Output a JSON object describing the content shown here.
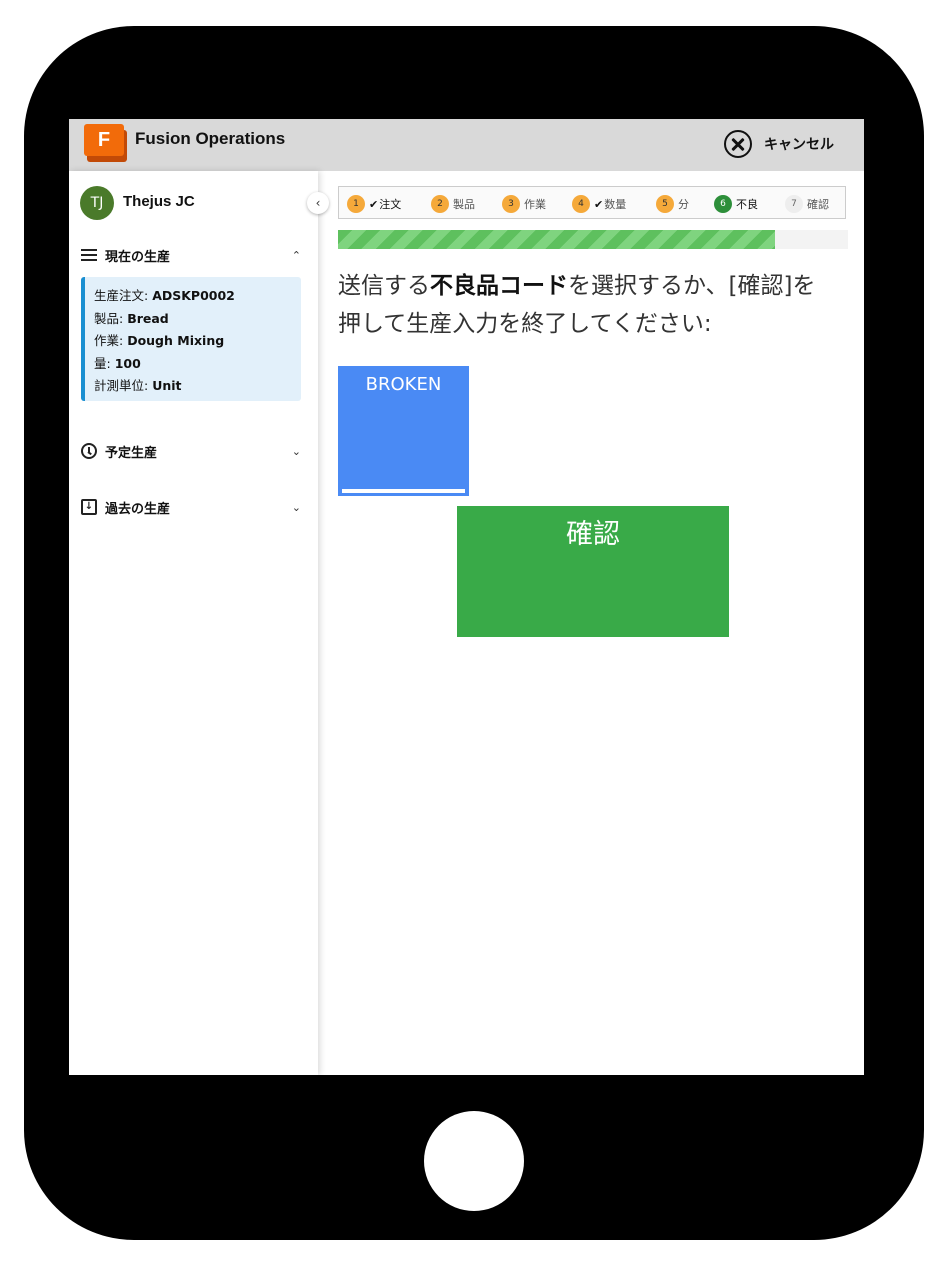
{
  "header": {
    "logo_letter": "F",
    "app_title": "Fusion Operations",
    "cancel_label": "キャンセル"
  },
  "sidebar": {
    "user_initials": "TJ",
    "user_name": "Thejus JC",
    "collapse_glyph": "‹",
    "current": {
      "title": "現在の生産",
      "rows": [
        {
          "label": "生産注文: ",
          "value": "ADSKP0002"
        },
        {
          "label": "製品: ",
          "value": "Bread"
        },
        {
          "label": "作業: ",
          "value": "Dough Mixing"
        },
        {
          "label": "量: ",
          "value": "100"
        },
        {
          "label": "計測単位: ",
          "value": "Unit"
        }
      ]
    },
    "scheduled": {
      "title": "予定生産"
    },
    "past": {
      "title": "過去の生産"
    }
  },
  "steps": [
    {
      "num": "1",
      "label": "注文",
      "checked": true,
      "state": "orange"
    },
    {
      "num": "2",
      "label": "製品",
      "checked": false,
      "state": "orange"
    },
    {
      "num": "3",
      "label": "作業",
      "checked": false,
      "state": "orange"
    },
    {
      "num": "4",
      "label": "数量",
      "checked": true,
      "state": "orange"
    },
    {
      "num": "5",
      "label": "分",
      "checked": false,
      "state": "orange"
    },
    {
      "num": "6",
      "label": "不良",
      "checked": false,
      "state": "green"
    },
    {
      "num": "7",
      "label": "確認",
      "checked": false,
      "state": "grey"
    }
  ],
  "progress_percent": 85.7,
  "prompt": {
    "before": "送信する",
    "bold": "不良品コード",
    "after": "を選択するか、[確認]を押して生産入力を終了してください:"
  },
  "defect_code": "BROKEN",
  "confirm_label": "確認",
  "colors": {
    "accent_orange": "#f5a93a",
    "active_green": "#2d8f3a",
    "tile_blue": "#4a8af4",
    "confirm_green": "#39aa48",
    "card_border": "#1a8fd1"
  }
}
